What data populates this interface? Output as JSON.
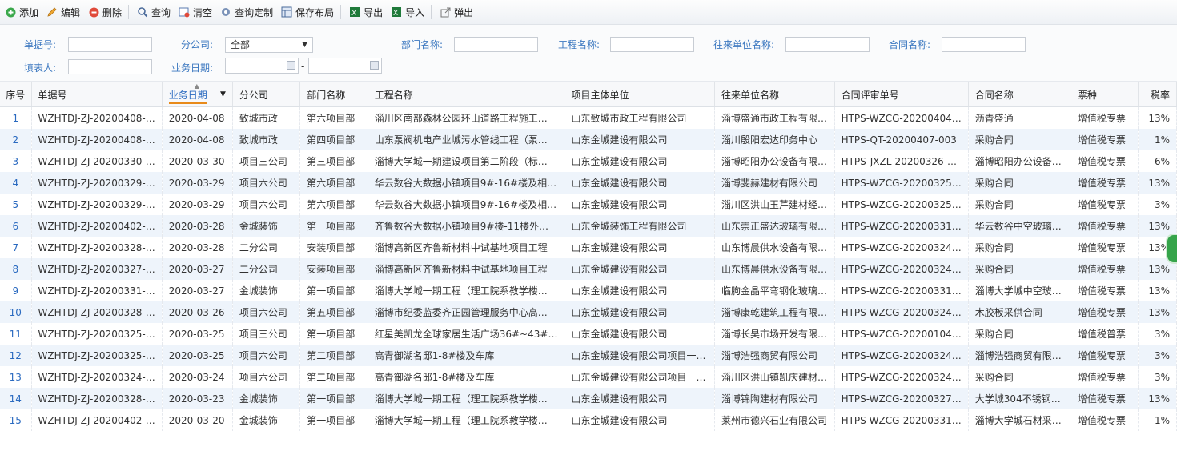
{
  "toolbar": {
    "add": "添加",
    "edit": "编辑",
    "delete": "删除",
    "query": "查询",
    "clear": "清空",
    "query_custom": "查询定制",
    "save_layout": "保存布局",
    "export": "导出",
    "import": "导入",
    "popup": "弹出"
  },
  "form": {
    "doc_no_label": "单据号:",
    "doc_no_value": "",
    "branch_label": "分公司:",
    "branch_value": "全部",
    "dept_label": "部门名称:",
    "dept_value": "",
    "project_label": "工程名称:",
    "project_value": "",
    "partner_label": "往来单位名称:",
    "partner_value": "",
    "contract_label": "合同名称:",
    "contract_value": "",
    "filler_label": "填表人:",
    "filler_value": "",
    "date_label": "业务日期:",
    "date_sep": "-",
    "date_from": "",
    "date_to": ""
  },
  "grid": {
    "headers": [
      "序号",
      "单据号",
      "业务日期",
      "分公司",
      "部门名称",
      "工程名称",
      "项目主体单位",
      "往来单位名称",
      "合同评审单号",
      "合同名称",
      "票种",
      "税率"
    ],
    "rows": [
      [
        "1",
        "WZHTDJ-ZJ-20200408-…",
        "2020-04-08",
        "致城市政",
        "第六项目部",
        "淄川区南部森林公园环山道路工程施工…",
        "山东致城市政工程有限公司",
        "淄博盛通市政工程有限…",
        "HTPS-WZCG-20200404…",
        "沥青盛通",
        "增值税专票",
        "13%"
      ],
      [
        "2",
        "WZHTDJ-ZJ-20200408-…",
        "2020-04-08",
        "致城市政",
        "第四项目部",
        "山东泵阀机电产业城污水管线工程（泵…",
        "山东金城建设有限公司",
        "淄川殷阳宏达印务中心",
        "HTPS-QT-20200407-003",
        "采购合同",
        "增值税专票",
        "1%"
      ],
      [
        "3",
        "WZHTDJ-ZJ-20200330-…",
        "2020-03-30",
        "项目三公司",
        "第三项目部",
        "淄博大学城一期建设项目第二阶段（标…",
        "山东金城建设有限公司",
        "淄博昭阳办公设备有限…",
        "HTPS-JXZL-20200326-…",
        "淄博昭阳办公设备…",
        "增值税专票",
        "6%"
      ],
      [
        "4",
        "WZHTDJ-ZJ-20200329-…",
        "2020-03-29",
        "项目六公司",
        "第六项目部",
        "华云数谷大数据小镇项目9#-16#楼及相…",
        "山东金城建设有限公司",
        "淄博斐赫建材有限公司",
        "HTPS-WZCG-20200325…",
        "采购合同",
        "增值税专票",
        "13%"
      ],
      [
        "5",
        "WZHTDJ-ZJ-20200329-…",
        "2020-03-29",
        "项目六公司",
        "第六项目部",
        "华云数谷大数据小镇项目9#-16#楼及相…",
        "山东金城建设有限公司",
        "淄川区洪山玉芹建材经…",
        "HTPS-WZCG-20200325…",
        "采购合同",
        "增值税专票",
        "3%"
      ],
      [
        "6",
        "WZHTDJ-ZJ-20200402-…",
        "2020-03-28",
        "金城装饰",
        "第一项目部",
        "齐鲁数谷大数据小镇项目9#楼-11楼外…",
        "山东金城装饰工程有限公司",
        "山东崇正盛达玻璃有限…",
        "HTPS-WZCG-20200331…",
        "华云数谷中空玻璃…",
        "增值税专票",
        "13%"
      ],
      [
        "7",
        "WZHTDJ-ZJ-20200328-…",
        "2020-03-28",
        "二分公司",
        "安装项目部",
        "淄博高新区齐鲁新材料中试基地项目工程",
        "山东金城建设有限公司",
        "山东博晨供水设备有限…",
        "HTPS-WZCG-20200324…",
        "采购合同",
        "增值税专票",
        "13%"
      ],
      [
        "8",
        "WZHTDJ-ZJ-20200327-…",
        "2020-03-27",
        "二分公司",
        "安装项目部",
        "淄博高新区齐鲁新材料中试基地项目工程",
        "山东金城建设有限公司",
        "山东博晨供水设备有限…",
        "HTPS-WZCG-20200324…",
        "采购合同",
        "增值税专票",
        "13%"
      ],
      [
        "9",
        "WZHTDJ-ZJ-20200331-…",
        "2020-03-27",
        "金城装饰",
        "第一项目部",
        "淄博大学城一期工程（理工院系教学楼…",
        "山东金城建设有限公司",
        "临朐金晶平弯钢化玻璃…",
        "HTPS-WZCG-20200331…",
        "淄博大学城中空玻…",
        "增值税专票",
        "13%"
      ],
      [
        "10",
        "WZHTDJ-ZJ-20200328-…",
        "2020-03-26",
        "项目六公司",
        "第五项目部",
        "淄博市纪委监委齐正园管理服务中心高…",
        "山东金城建设有限公司",
        "淄博康乾建筑工程有限…",
        "HTPS-WZCG-20200324…",
        "木胶板采供合同",
        "增值税专票",
        "13%"
      ],
      [
        "11",
        "WZHTDJ-ZJ-20200325-…",
        "2020-03-25",
        "项目三公司",
        "第一项目部",
        "红星美凯龙全球家居生活广场36#~43#…",
        "山东金城建设有限公司",
        "淄博长昊市场开发有限…",
        "HTPS-WZCG-20200104…",
        "采购合同",
        "增值税普票",
        "3%"
      ],
      [
        "12",
        "WZHTDJ-ZJ-20200325-…",
        "2020-03-25",
        "项目六公司",
        "第二项目部",
        "高青御湖名邸1-8#楼及车库",
        "山东金城建设有限公司项目一…",
        "淄博浩强商贸有限公司",
        "HTPS-WZCG-20200324…",
        "淄博浩强商贸有限…",
        "增值税专票",
        "3%"
      ],
      [
        "13",
        "WZHTDJ-ZJ-20200324-…",
        "2020-03-24",
        "项目六公司",
        "第二项目部",
        "高青御湖名邸1-8#楼及车库",
        "山东金城建设有限公司项目一…",
        "淄川区洪山镇凯庆建材…",
        "HTPS-WZCG-20200324…",
        "采购合同",
        "增值税专票",
        "3%"
      ],
      [
        "14",
        "WZHTDJ-ZJ-20200328-…",
        "2020-03-23",
        "金城装饰",
        "第一项目部",
        "淄博大学城一期工程（理工院系教学楼…",
        "山东金城建设有限公司",
        "淄博锦陶建材有限公司",
        "HTPS-WZCG-20200327…",
        "大学城304不锈钢…",
        "增值税专票",
        "13%"
      ],
      [
        "15",
        "WZHTDJ-ZJ-20200402-…",
        "2020-03-20",
        "金城装饰",
        "第一项目部",
        "淄博大学城一期工程（理工院系教学楼…",
        "山东金城建设有限公司",
        "莱州市德兴石业有限公司",
        "HTPS-WZCG-20200331…",
        "淄博大学城石材采…",
        "增值税专票",
        "1%"
      ]
    ]
  },
  "colors": {
    "accent": "#2a6ac0",
    "label": "#3c78c0",
    "row_alt": "#eef4fb",
    "sort_underline": "#e88a1a"
  }
}
